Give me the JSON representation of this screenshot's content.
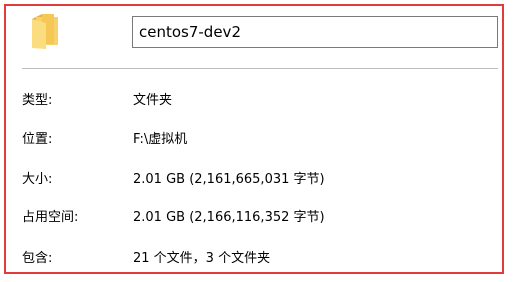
{
  "folder": {
    "icon": "folder-icon",
    "name": "centos7-dev2"
  },
  "properties": [
    {
      "label": "类型:",
      "value": "文件夹"
    },
    {
      "label": "位置:",
      "value": "F:\\虚拟机"
    },
    {
      "label": "大小:",
      "value": "2.01 GB (2,161,665,031 字节)"
    },
    {
      "label": "占用空间:",
      "value": "2.01 GB (2,166,116,352 字节)"
    },
    {
      "label": "包含:",
      "value": "21 个文件，3 个文件夹"
    }
  ],
  "colors": {
    "highlight_border": "#e23b3b",
    "folder": "#f5c755"
  }
}
